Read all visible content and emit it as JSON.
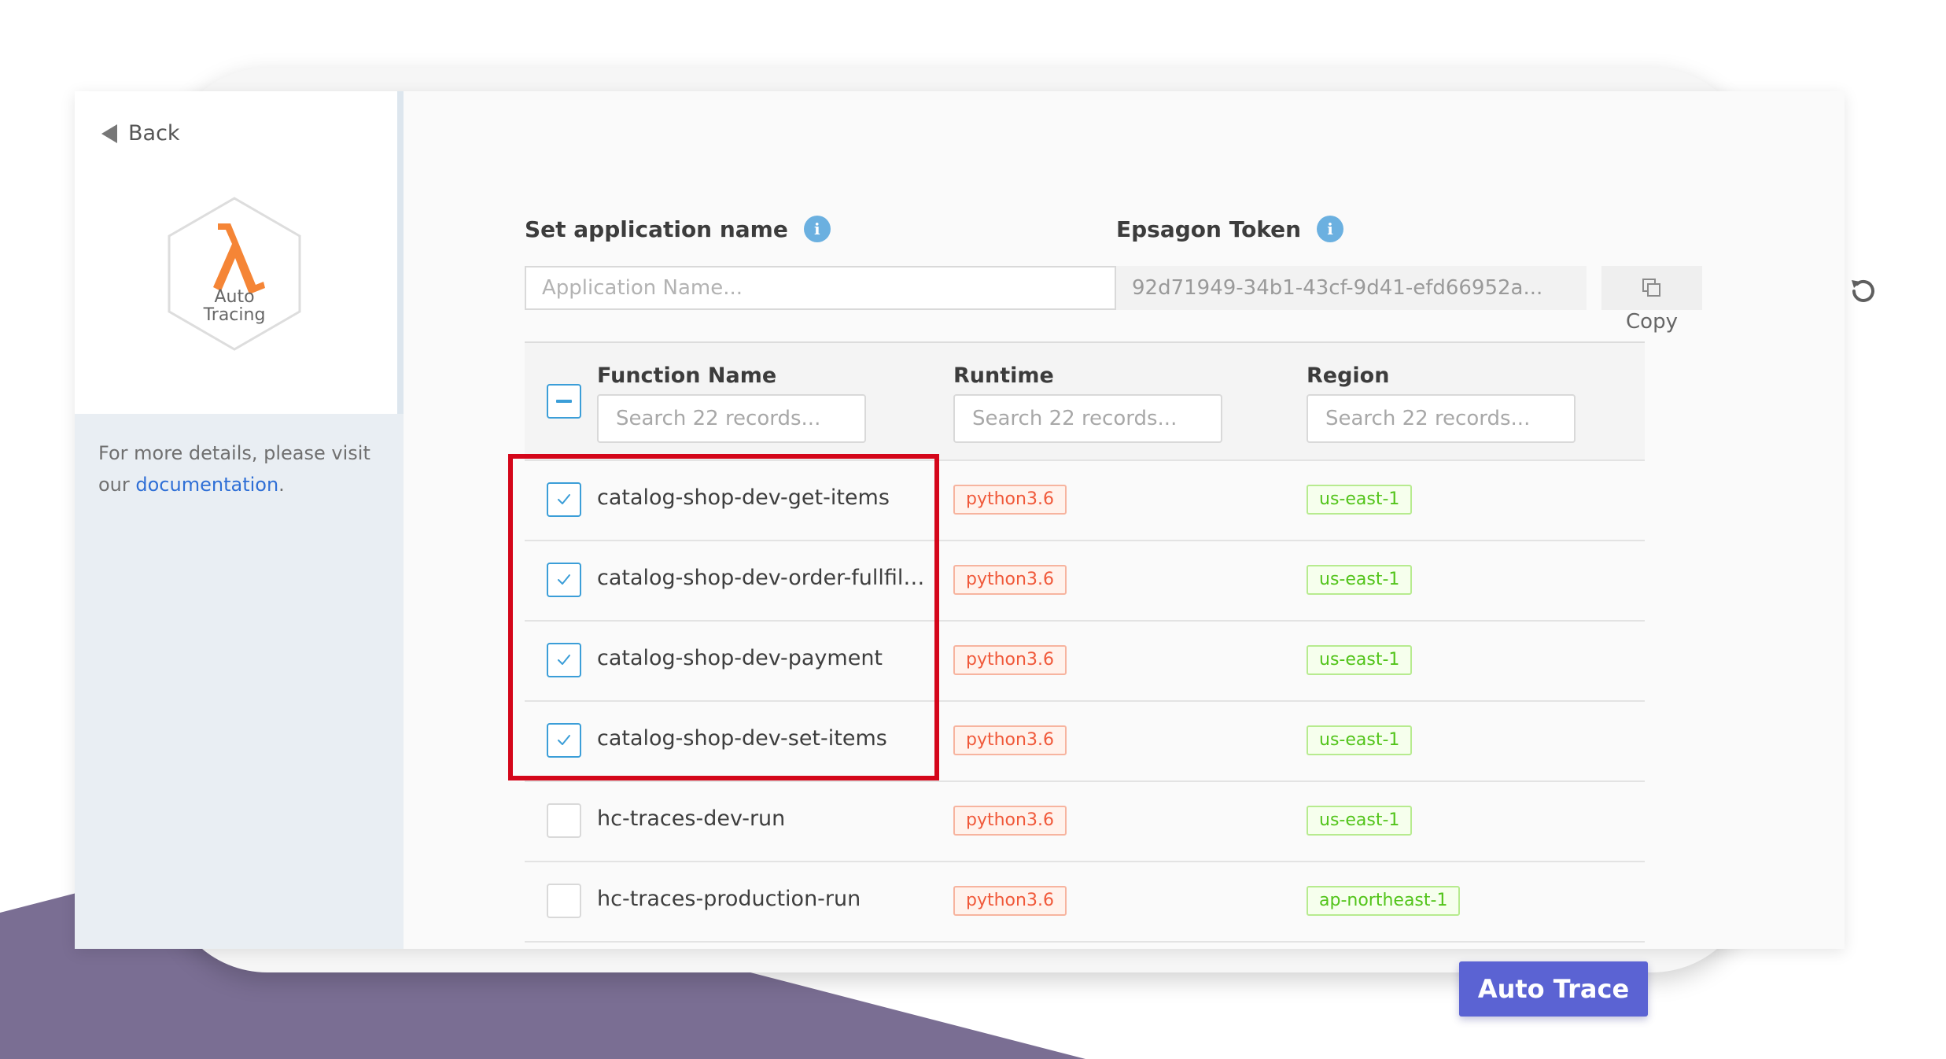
{
  "sidebar": {
    "back_label": "Back",
    "logo_line1": "Auto",
    "logo_line2": "Tracing",
    "details_text": "For more details, please visit our ",
    "details_link": "documentation",
    "details_end": "."
  },
  "form": {
    "app_name_label": "Set application name",
    "app_name_placeholder": "Application Name...",
    "token_label": "Epsagon Token",
    "token_value": "92d71949-34b1-43cf-9d41-efd66952a...",
    "copy_label": "Copy"
  },
  "table": {
    "columns": [
      {
        "label": "Function Name",
        "search_placeholder": "Search 22 records..."
      },
      {
        "label": "Runtime",
        "search_placeholder": "Search 22 records..."
      },
      {
        "label": "Region",
        "search_placeholder": "Search 22 records..."
      }
    ],
    "rows": [
      {
        "name": "catalog-shop-dev-get-items",
        "runtime": "python3.6",
        "region": "us-east-1",
        "checked": true
      },
      {
        "name": "catalog-shop-dev-order-fullfilm...",
        "runtime": "python3.6",
        "region": "us-east-1",
        "checked": true
      },
      {
        "name": "catalog-shop-dev-payment",
        "runtime": "python3.6",
        "region": "us-east-1",
        "checked": true
      },
      {
        "name": "catalog-shop-dev-set-items",
        "runtime": "python3.6",
        "region": "us-east-1",
        "checked": true
      },
      {
        "name": "hc-traces-dev-run",
        "runtime": "python3.6",
        "region": "us-east-1",
        "checked": false
      },
      {
        "name": "hc-traces-production-run",
        "runtime": "python3.6",
        "region": "ap-northeast-1",
        "checked": false
      }
    ]
  },
  "actions": {
    "auto_trace_label": "Auto Trace"
  },
  "colors": {
    "accent": "#5b63d3",
    "checkbox": "#3b9ed8",
    "highlight": "#d4061a",
    "lambda": "#f58536",
    "background_shape": "#7a6e93"
  },
  "icons": {
    "back": "back-arrow-icon",
    "logo": "lambda-icon",
    "info": "info-icon",
    "copy": "copy-icon",
    "refresh": "refresh-icon",
    "check": "check-icon"
  }
}
